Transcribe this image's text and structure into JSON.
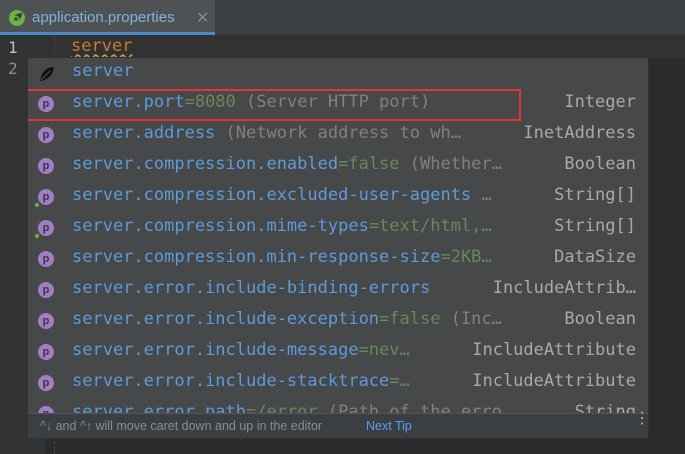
{
  "tab": {
    "title": "application.properties",
    "close_glyph": "✕",
    "icon": "leaf-icon"
  },
  "editor": {
    "line_numbers": [
      "1",
      "2"
    ],
    "line1_text": "server"
  },
  "popup": {
    "items": [
      {
        "icon": "leaf",
        "key": "server",
        "value": "",
        "desc": "",
        "type": "",
        "dot": false
      },
      {
        "icon": "p",
        "key": "server",
        "rest": ".port",
        "value": "=8080",
        "desc": " (Server HTTP port)",
        "type": "Integer",
        "dot": false,
        "highlighted": true
      },
      {
        "icon": "p",
        "key": "server",
        "rest": ".address",
        "value": "",
        "desc": " (Network address to wh…",
        "type": "InetAddress",
        "dot": false
      },
      {
        "icon": "p",
        "key": "server",
        "rest": ".compression.enabled",
        "value": "=false",
        "desc": " (Whether…",
        "type": "Boolean",
        "dot": false
      },
      {
        "icon": "p",
        "key": "server",
        "rest": ".compression.excluded-user-agents",
        "value": "",
        "desc": " …",
        "type": "String[]",
        "dot": true
      },
      {
        "icon": "p",
        "key": "server",
        "rest": ".compression.mime-types",
        "value": "=text/html,…",
        "desc": "",
        "type": "String[]",
        "dot": true
      },
      {
        "icon": "p",
        "key": "server",
        "rest": ".compression.min-response-size",
        "value": "=2KB…",
        "desc": "",
        "type": "DataSize",
        "dot": false
      },
      {
        "icon": "p",
        "key": "server",
        "rest": ".error.include-binding-errors",
        "value": "",
        "desc": "",
        "type": "IncludeAttrib…",
        "dot": false
      },
      {
        "icon": "p",
        "key": "server",
        "rest": ".error.include-exception",
        "value": "=false",
        "desc": " (Inc…",
        "type": "Boolean",
        "dot": false
      },
      {
        "icon": "p",
        "key": "server",
        "rest": ".error.include-message",
        "value": "=nev…",
        "desc": "",
        "type": "IncludeAttribute",
        "dot": false
      },
      {
        "icon": "p",
        "key": "server",
        "rest": ".error.include-stacktrace",
        "value": "=…",
        "desc": "",
        "type": "IncludeAttribute",
        "dot": false
      },
      {
        "icon": "p",
        "key": "server",
        "rest": ".error.path",
        "value": "=/error",
        "desc": " (Path of the erro…",
        "type": "String",
        "dot": false
      }
    ],
    "footer_hint": "^↓ and ^↑ will move caret down and up in the editor",
    "next_tip": "Next Tip",
    "more_glyph": "⋮"
  },
  "colors": {
    "key": "#5d9bd9",
    "value": "#6a8759",
    "highlight_border": "#e0363b",
    "property_icon": "#9f7fc2"
  }
}
